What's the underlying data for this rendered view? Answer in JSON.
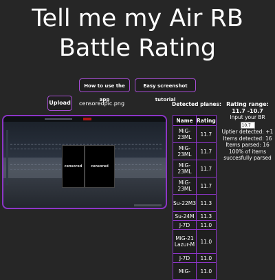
{
  "header": {
    "title_line1": "Tell me my Air RB",
    "title_line2": "Battle Rating"
  },
  "buttons": {
    "how_to": "How to use the app",
    "tutorial": "Easy screenshot tutorial",
    "upload": "Upload"
  },
  "upload": {
    "filename": "censoredpic.png"
  },
  "preview": {
    "panel_left": "censored",
    "panel_right": "censored"
  },
  "detected": {
    "label": "Detected planes:",
    "columns": [
      "Name",
      "Rating"
    ],
    "rows": [
      {
        "name": "MiG-23ML",
        "rating": "11.7"
      },
      {
        "name": "MiG-23ML",
        "rating": "11.7"
      },
      {
        "name": "MiG-23ML",
        "rating": "11.7"
      },
      {
        "name": "MiG-23ML",
        "rating": "11.7"
      },
      {
        "name": "Su-22M3",
        "rating": "11.3"
      },
      {
        "name": "Su-24M",
        "rating": "11.3"
      },
      {
        "name": "J-7D",
        "rating": "11.0"
      },
      {
        "name": "MiG-21 Lazur-M",
        "rating": "11.0"
      },
      {
        "name": "J-7D",
        "rating": "11.0"
      },
      {
        "name": "MiG-",
        "rating": "11.0"
      }
    ]
  },
  "info": {
    "range": "Rating range: 11.7 -10.7",
    "input_label": "Input your BR",
    "input_value": "10.7",
    "uptier": "Uptier detected: +1",
    "items_detected": "Items detected: 16",
    "items_parsed": "Items parsed: 16",
    "success": "100% of items succesfully parsed"
  }
}
